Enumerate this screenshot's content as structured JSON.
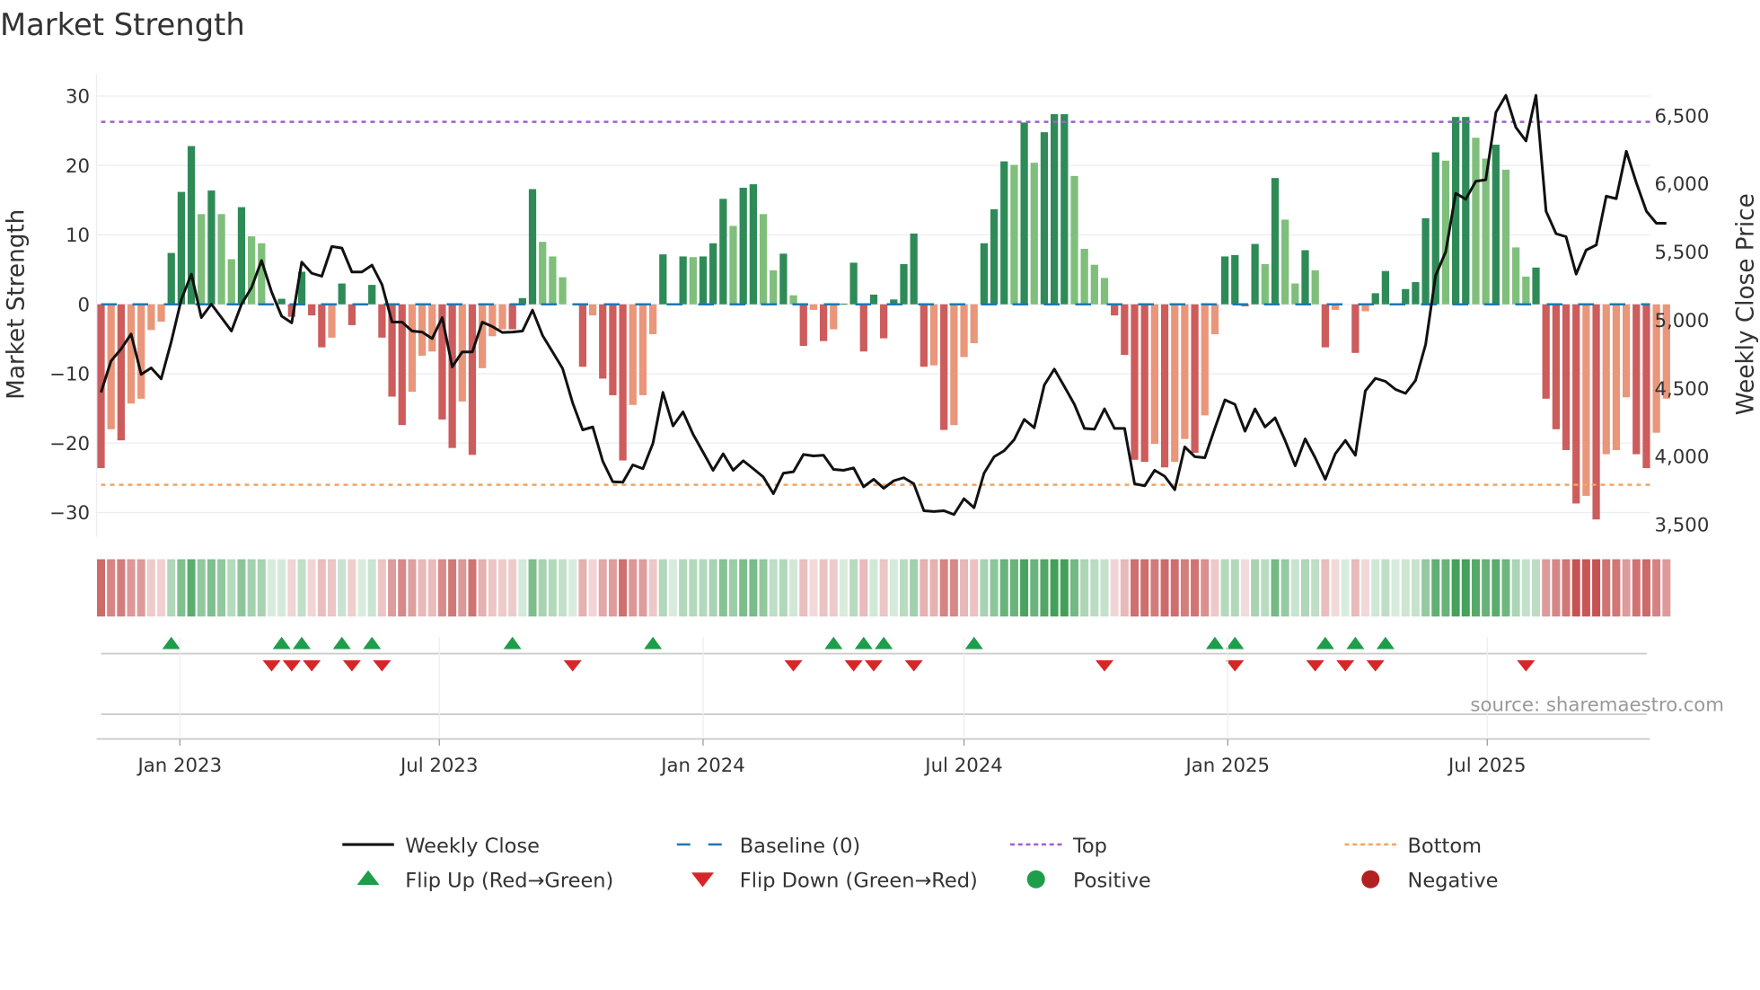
{
  "title": "Market Strength",
  "source": "source: sharemaestro.com",
  "chart_data": {
    "type": "bar",
    "title": "Market Strength",
    "ylabel": "Market Strength",
    "y2label": "Weekly Close Price",
    "ylim": [
      -33,
      33
    ],
    "y2lim": [
      3400,
      6720
    ],
    "yticks": [
      30,
      20,
      10,
      0,
      -10,
      -20,
      -30
    ],
    "ytick_labels": [
      "30",
      "20",
      "10",
      "0",
      "−10",
      "−20",
      "−30"
    ],
    "y2ticks": [
      6500,
      6000,
      5500,
      5000,
      4500,
      4000,
      3500
    ],
    "y2tick_labels": [
      "6,500",
      "6,000",
      "5,500",
      "5,000",
      "4,500",
      "4,000",
      "3,500"
    ],
    "start_date": "2022-11-07",
    "frequency": "weekly",
    "xticks": [
      {
        "date": "2023-01-01",
        "label": "Jan 2023"
      },
      {
        "date": "2023-07-01",
        "label": "Jul 2023"
      },
      {
        "date": "2024-01-01",
        "label": "Jan 2024"
      },
      {
        "date": "2024-07-01",
        "label": "Jul 2024"
      },
      {
        "date": "2025-01-01",
        "label": "Jan 2025"
      },
      {
        "date": "2025-07-01",
        "label": "Jul 2025"
      }
    ],
    "top_level": 26.3,
    "bottom_level": -26,
    "strength": [
      -23.6,
      -18,
      -19.6,
      -14.3,
      -13.6,
      -3.7,
      -2.5,
      7.4,
      16.2,
      22.8,
      13,
      16.4,
      13,
      6.5,
      14,
      9.8,
      8.8,
      0,
      0.8,
      -1.8,
      4.7,
      -1.6,
      -6.2,
      -4.8,
      3,
      -3,
      0,
      2.8,
      -4.8,
      -13.3,
      -17.4,
      -12.6,
      -7.4,
      -6.8,
      -16.6,
      -20.7,
      -14,
      -21.7,
      -9.2,
      -4.6,
      -3.6,
      -3.6,
      0.9,
      16.6,
      9,
      6.9,
      3.9,
      0,
      -9,
      -1.6,
      -10.7,
      -13.1,
      -22.5,
      -14.5,
      -13.1,
      -4.3,
      7.2,
      0,
      6.9,
      6.8,
      6.9,
      8.8,
      15.2,
      11.3,
      16.8,
      17.3,
      13,
      4.9,
      7.3,
      1.3,
      -6,
      -0.8,
      -5.3,
      -3.6,
      0.1,
      6,
      -6.8,
      1.4,
      -4.9,
      0.7,
      5.8,
      10.2,
      -9,
      -8.8,
      -18.1,
      -17.4,
      -7.6,
      -5.6,
      8.8,
      13.7,
      20.6,
      20.1,
      26.2,
      20.4,
      24.8,
      27.4,
      27.4,
      18.5,
      8,
      5.7,
      3.8,
      -1.6,
      -7.3,
      -22.4,
      -22.7,
      -20.1,
      -23.5,
      -22.7,
      -19.4,
      -21.4,
      -16,
      -4.3,
      6.9,
      7.1,
      -0.3,
      8.7,
      5.8,
      18.2,
      12.2,
      3,
      7.8,
      4.9,
      -6.2,
      -0.8,
      0,
      -7,
      -1,
      1.6,
      4.8,
      0,
      2.2,
      3.2,
      12.4,
      21.9,
      20.7,
      27,
      27,
      24,
      21,
      23,
      19.4,
      8.2,
      4,
      5.3,
      -13.6,
      -18,
      -21,
      -28.7,
      -27.6,
      -31,
      -21.6,
      -21,
      -13.4,
      -21.6,
      -23.6,
      -18.5,
      -13.6
    ],
    "weekly_close": [
      4470,
      4700,
      4789,
      4898,
      4602,
      4650,
      4569,
      4843,
      5151,
      5338,
      5019,
      5118,
      5019,
      4920,
      5118,
      5239,
      5437,
      5206,
      5030,
      4980,
      5426,
      5344,
      5322,
      5540,
      5529,
      5353,
      5353,
      5404,
      5261,
      4986,
      4986,
      4920,
      4913,
      4865,
      5019,
      4657,
      4767,
      4767,
      4986,
      4953,
      4909,
      4913,
      4920,
      5074,
      4887,
      4767,
      4646,
      4393,
      4195,
      4217,
      3965,
      3815,
      3811,
      3938,
      3910,
      4096,
      4470,
      4224,
      4327,
      4162,
      4031,
      3899,
      4020,
      3899,
      3969,
      3910,
      3850,
      3727,
      3877,
      3888,
      4015,
      4004,
      4009,
      3905,
      3899,
      3916,
      3778,
      3833,
      3767,
      3822,
      3844,
      3800,
      3602,
      3596,
      3602,
      3574,
      3690,
      3624,
      3877,
      3998,
      4042,
      4123,
      4272,
      4211,
      4525,
      4641,
      4514,
      4382,
      4206,
      4200,
      4349,
      4206,
      4206,
      3800,
      3785,
      3899,
      3855,
      3756,
      4070,
      3998,
      3991,
      4206,
      4415,
      4382,
      4185,
      4349,
      4217,
      4283,
      4118,
      3932,
      4129,
      3991,
      3833,
      4020,
      4118,
      4009,
      4481,
      4573,
      4551,
      4492,
      4463,
      4558,
      4821,
      5327,
      5502,
      5931,
      5887,
      6019,
      6030,
      6524,
      6649,
      6414,
      6315,
      6649,
      5799,
      5634,
      5612,
      5338,
      5514,
      5551,
      5909,
      5891,
      6239,
      6008,
      5799,
      5711,
      5711
    ],
    "flip_up_weeks": [
      7,
      18,
      20,
      24,
      27,
      41,
      55,
      73,
      76,
      78,
      87,
      111,
      113,
      122,
      125,
      128
    ],
    "flip_down_weeks": [
      17,
      19,
      21,
      25,
      28,
      47,
      69,
      75,
      77,
      81,
      100,
      113,
      121,
      124,
      127,
      142
    ],
    "legend": [
      {
        "label": "Weekly Close",
        "kind": "line"
      },
      {
        "label": "Baseline (0)",
        "kind": "baseline"
      },
      {
        "label": "Top",
        "kind": "top"
      },
      {
        "label": "Bottom",
        "kind": "bottom"
      },
      {
        "label": "Flip Up (Red→Green)",
        "kind": "flip-up"
      },
      {
        "label": "Flip Down (Green→Red)",
        "kind": "flip-down"
      },
      {
        "label": "Positive",
        "kind": "positive"
      },
      {
        "label": "Negative",
        "kind": "negative"
      }
    ],
    "legend_placement": "bottom",
    "colors": {
      "pos_up": "#2e8b57",
      "pos_down": "#7fbf7b",
      "neg_down": "#cd5c5c",
      "neg_up": "#e9967a",
      "close": "#111111",
      "baseline": "#1f77b4",
      "top": "#9b5fd6",
      "bottom": "#f4a460",
      "flip_up": "#1e9e4a",
      "flip_down": "#d62728",
      "positive": "#1e9e4a",
      "negative": "#b22222"
    }
  }
}
